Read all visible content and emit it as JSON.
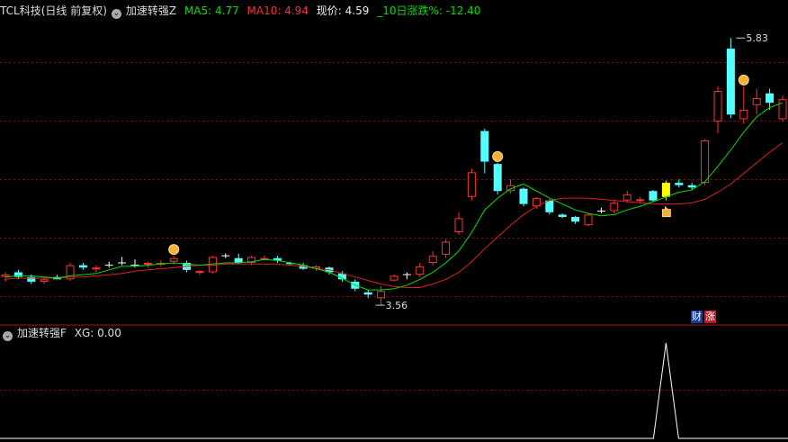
{
  "main_header": {
    "title": "TCL科技(日线 前复权)",
    "indicator_name": "加速转强Z",
    "ma5_text": "MA5: 4.77",
    "ma10_text": "MA10: 4.94",
    "price_text": "现价: 4.59",
    "change_text": "_10日涨跌%: -12.40"
  },
  "sub_header": {
    "indicator_name": "加速转强F",
    "value_text": "XG: 0.00"
  },
  "badges": {
    "cai": "财",
    "zhang": "涨"
  },
  "colors": {
    "up": "#ff3232",
    "down": "#54ffff",
    "signal": "#ffff00",
    "ma5": "#00e000",
    "ma10": "#e02020",
    "white": "#ffffff",
    "grid": "#a00000"
  },
  "chart_data": {
    "type": "candlestick",
    "price_range": [
      3.4,
      6.0
    ],
    "annotations": {
      "high": "5.83",
      "low": "3.56"
    },
    "candles": [
      {
        "o": 3.8,
        "h": 3.84,
        "l": 3.76,
        "c": 3.82,
        "k": "up"
      },
      {
        "o": 3.84,
        "h": 3.86,
        "l": 3.78,
        "c": 3.8,
        "k": "down"
      },
      {
        "o": 3.8,
        "h": 3.82,
        "l": 3.74,
        "c": 3.76,
        "k": "down"
      },
      {
        "o": 3.76,
        "h": 3.8,
        "l": 3.74,
        "c": 3.78,
        "k": "up"
      },
      {
        "o": 3.8,
        "h": 3.82,
        "l": 3.78,
        "c": 3.78,
        "k": "down"
      },
      {
        "o": 3.78,
        "h": 3.92,
        "l": 3.77,
        "c": 3.9,
        "k": "up"
      },
      {
        "o": 3.9,
        "h": 3.92,
        "l": 3.86,
        "c": 3.88,
        "k": "down"
      },
      {
        "o": 3.88,
        "h": 3.9,
        "l": 3.84,
        "c": 3.87,
        "k": "up"
      },
      {
        "o": 3.9,
        "h": 3.93,
        "l": 3.88,
        "c": 3.9,
        "k": "doji"
      },
      {
        "o": 3.92,
        "h": 3.97,
        "l": 3.9,
        "c": 3.92,
        "k": "doji"
      },
      {
        "o": 3.9,
        "h": 3.95,
        "l": 3.88,
        "c": 3.9,
        "k": "doji"
      },
      {
        "o": 3.91,
        "h": 3.93,
        "l": 3.88,
        "c": 3.92,
        "k": "up"
      },
      {
        "o": 3.91,
        "h": 3.94,
        "l": 3.89,
        "c": 3.92,
        "k": "up"
      },
      {
        "o": 3.93,
        "h": 3.98,
        "l": 3.91,
        "c": 3.96,
        "k": "up"
      },
      {
        "o": 3.92,
        "h": 3.94,
        "l": 3.84,
        "c": 3.86,
        "k": "down"
      },
      {
        "o": 3.84,
        "h": 3.86,
        "l": 3.82,
        "c": 3.85,
        "k": "up"
      },
      {
        "o": 3.84,
        "h": 3.98,
        "l": 3.83,
        "c": 3.97,
        "k": "up"
      },
      {
        "o": 3.98,
        "h": 4.0,
        "l": 3.96,
        "c": 3.98,
        "k": "doji"
      },
      {
        "o": 3.96,
        "h": 4.0,
        "l": 3.91,
        "c": 3.92,
        "k": "down"
      },
      {
        "o": 3.92,
        "h": 3.98,
        "l": 3.9,
        "c": 3.97,
        "k": "up"
      },
      {
        "o": 3.96,
        "h": 3.98,
        "l": 3.94,
        "c": 3.96,
        "k": "up"
      },
      {
        "o": 3.96,
        "h": 3.98,
        "l": 3.92,
        "c": 3.94,
        "k": "down"
      },
      {
        "o": 3.92,
        "h": 3.93,
        "l": 3.9,
        "c": 3.91,
        "k": "down"
      },
      {
        "o": 3.9,
        "h": 3.92,
        "l": 3.86,
        "c": 3.87,
        "k": "down"
      },
      {
        "o": 3.87,
        "h": 3.9,
        "l": 3.85,
        "c": 3.89,
        "k": "up"
      },
      {
        "o": 3.88,
        "h": 3.89,
        "l": 3.82,
        "c": 3.84,
        "k": "down"
      },
      {
        "o": 3.83,
        "h": 3.85,
        "l": 3.76,
        "c": 3.78,
        "k": "down"
      },
      {
        "o": 3.76,
        "h": 3.78,
        "l": 3.68,
        "c": 3.7,
        "k": "down"
      },
      {
        "o": 3.67,
        "h": 3.69,
        "l": 3.62,
        "c": 3.65,
        "k": "down"
      },
      {
        "o": 3.62,
        "h": 3.72,
        "l": 3.56,
        "c": 3.68,
        "k": "up"
      },
      {
        "o": 3.77,
        "h": 3.82,
        "l": 3.76,
        "c": 3.81,
        "k": "up"
      },
      {
        "o": 3.8,
        "h": 3.84,
        "l": 3.78,
        "c": 3.82,
        "k": "doji"
      },
      {
        "o": 3.82,
        "h": 3.92,
        "l": 3.8,
        "c": 3.89,
        "k": "up"
      },
      {
        "o": 3.92,
        "h": 4.02,
        "l": 3.9,
        "c": 3.98,
        "k": "up"
      },
      {
        "o": 3.99,
        "h": 4.12,
        "l": 3.96,
        "c": 4.1,
        "k": "up"
      },
      {
        "o": 4.18,
        "h": 4.35,
        "l": 4.16,
        "c": 4.3,
        "k": "up"
      },
      {
        "o": 4.48,
        "h": 4.72,
        "l": 4.45,
        "c": 4.69,
        "k": "up"
      },
      {
        "o": 5.04,
        "h": 5.06,
        "l": 4.68,
        "c": 4.78,
        "k": "down"
      },
      {
        "o": 4.76,
        "h": 4.77,
        "l": 4.5,
        "c": 4.53,
        "k": "down"
      },
      {
        "o": 4.53,
        "h": 4.63,
        "l": 4.51,
        "c": 4.58,
        "k": "up"
      },
      {
        "o": 4.55,
        "h": 4.56,
        "l": 4.4,
        "c": 4.42,
        "k": "down"
      },
      {
        "o": 4.4,
        "h": 4.48,
        "l": 4.38,
        "c": 4.47,
        "k": "up"
      },
      {
        "o": 4.45,
        "h": 4.46,
        "l": 4.33,
        "c": 4.35,
        "k": "down"
      },
      {
        "o": 4.33,
        "h": 4.34,
        "l": 4.3,
        "c": 4.31,
        "k": "down"
      },
      {
        "o": 4.31,
        "h": 4.32,
        "l": 4.25,
        "c": 4.27,
        "k": "down"
      },
      {
        "o": 4.24,
        "h": 4.34,
        "l": 4.23,
        "c": 4.33,
        "k": "up"
      },
      {
        "o": 4.36,
        "h": 4.39,
        "l": 4.34,
        "c": 4.36,
        "k": "doji"
      },
      {
        "o": 4.36,
        "h": 4.46,
        "l": 4.34,
        "c": 4.43,
        "k": "up"
      },
      {
        "o": 4.45,
        "h": 4.53,
        "l": 4.43,
        "c": 4.5,
        "k": "up"
      },
      {
        "o": 4.45,
        "h": 4.48,
        "l": 4.43,
        "c": 4.46,
        "k": "up"
      },
      {
        "o": 4.45,
        "h": 4.54,
        "l": 4.44,
        "c": 4.53,
        "k": "down"
      },
      {
        "o": 4.48,
        "h": 4.62,
        "l": 4.45,
        "c": 4.6,
        "k": "signal"
      },
      {
        "o": 4.6,
        "h": 4.63,
        "l": 4.56,
        "c": 4.58,
        "k": "down"
      },
      {
        "o": 4.58,
        "h": 4.6,
        "l": 4.54,
        "c": 4.56,
        "k": "down"
      },
      {
        "o": 4.6,
        "h": 4.97,
        "l": 4.58,
        "c": 4.96,
        "k": "up"
      },
      {
        "o": 5.12,
        "h": 5.42,
        "l": 5.02,
        "c": 5.38,
        "k": "up"
      },
      {
        "o": 5.74,
        "h": 5.83,
        "l": 5.15,
        "c": 5.18,
        "k": "down"
      },
      {
        "o": 5.14,
        "h": 5.42,
        "l": 5.1,
        "c": 5.22,
        "k": "up"
      },
      {
        "o": 5.32,
        "h": 5.4,
        "l": 5.18,
        "c": 5.26,
        "k": "up"
      },
      {
        "o": 5.36,
        "h": 5.4,
        "l": 5.22,
        "c": 5.28,
        "k": "down"
      },
      {
        "o": 5.14,
        "h": 5.34,
        "l": 5.12,
        "c": 5.31,
        "k": "up"
      }
    ],
    "ma5": [
      3.8,
      3.81,
      3.81,
      3.8,
      3.79,
      3.81,
      3.82,
      3.83,
      3.86,
      3.89,
      3.89,
      3.9,
      3.91,
      3.92,
      3.91,
      3.9,
      3.91,
      3.92,
      3.92,
      3.93,
      3.95,
      3.94,
      3.92,
      3.9,
      3.87,
      3.84,
      3.79,
      3.73,
      3.69,
      3.69,
      3.7,
      3.73,
      3.78,
      3.84,
      3.92,
      4.02,
      4.18,
      4.37,
      4.47,
      4.55,
      4.59,
      4.53,
      4.47,
      4.42,
      4.37,
      4.34,
      4.32,
      4.33,
      4.37,
      4.4,
      4.44,
      4.48,
      4.52,
      4.54,
      4.61,
      4.74,
      4.88,
      5.03,
      5.16,
      5.24,
      5.28
    ],
    "ma10": [
      3.78,
      3.79,
      3.79,
      3.79,
      3.79,
      3.8,
      3.8,
      3.81,
      3.82,
      3.83,
      3.85,
      3.86,
      3.87,
      3.88,
      3.89,
      3.9,
      3.9,
      3.91,
      3.91,
      3.91,
      3.91,
      3.91,
      3.9,
      3.89,
      3.87,
      3.86,
      3.83,
      3.8,
      3.77,
      3.74,
      3.72,
      3.71,
      3.71,
      3.74,
      3.78,
      3.84,
      3.93,
      4.04,
      4.14,
      4.24,
      4.33,
      4.4,
      4.45,
      4.47,
      4.47,
      4.47,
      4.46,
      4.45,
      4.44,
      4.43,
      4.42,
      4.42,
      4.42,
      4.43,
      4.46,
      4.52,
      4.59,
      4.68,
      4.77,
      4.86,
      4.94
    ],
    "xg": [
      0,
      0,
      0,
      0,
      0,
      0,
      0,
      0,
      0,
      0,
      0,
      0,
      0,
      0,
      0,
      0,
      0,
      0,
      0,
      0,
      0,
      0,
      0,
      0,
      0,
      0,
      0,
      0,
      0,
      0,
      0,
      0,
      0,
      0,
      0,
      0,
      0,
      0,
      0,
      0,
      0,
      0,
      0,
      0,
      0,
      0,
      0,
      0,
      0,
      0,
      0,
      1,
      0,
      0,
      0,
      0,
      0,
      0,
      0,
      0,
      0
    ],
    "markers": [
      {
        "index": 13,
        "icon": "sun-icon"
      },
      {
        "index": 38,
        "icon": "sun-icon"
      },
      {
        "index": 57,
        "icon": "sun-icon"
      },
      {
        "index": 51,
        "icon": "hand-icon"
      }
    ]
  }
}
